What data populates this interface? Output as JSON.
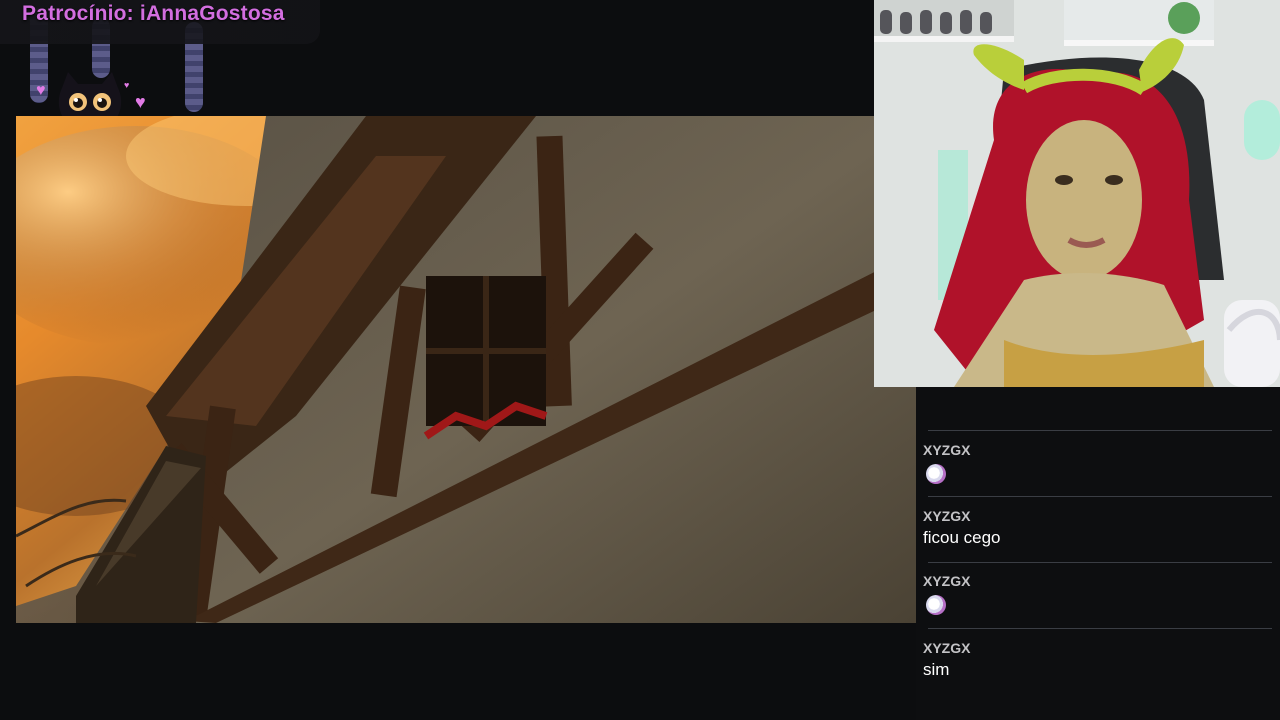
{
  "banner": {
    "sponsor_text": "Patrocínio: iAnnaGostosa"
  },
  "chat": {
    "messages": [
      {
        "user": "XYZGX",
        "text": "",
        "emote": "ghost-emote"
      },
      {
        "user": "XYZGX",
        "text": "ficou cego",
        "emote": ""
      },
      {
        "user": "XYZGX",
        "text": "",
        "emote": "ghost-emote"
      },
      {
        "user": "XYZGX",
        "text": "sim",
        "emote": ""
      }
    ]
  },
  "colors": {
    "sponsor": "#d36ee0",
    "chat_bg": "#0d0e10",
    "username": "#c3c3c6",
    "message": "#ffffff"
  },
  "icons": {
    "mascot": "black-cat-icon",
    "decor": "heart-icon"
  }
}
